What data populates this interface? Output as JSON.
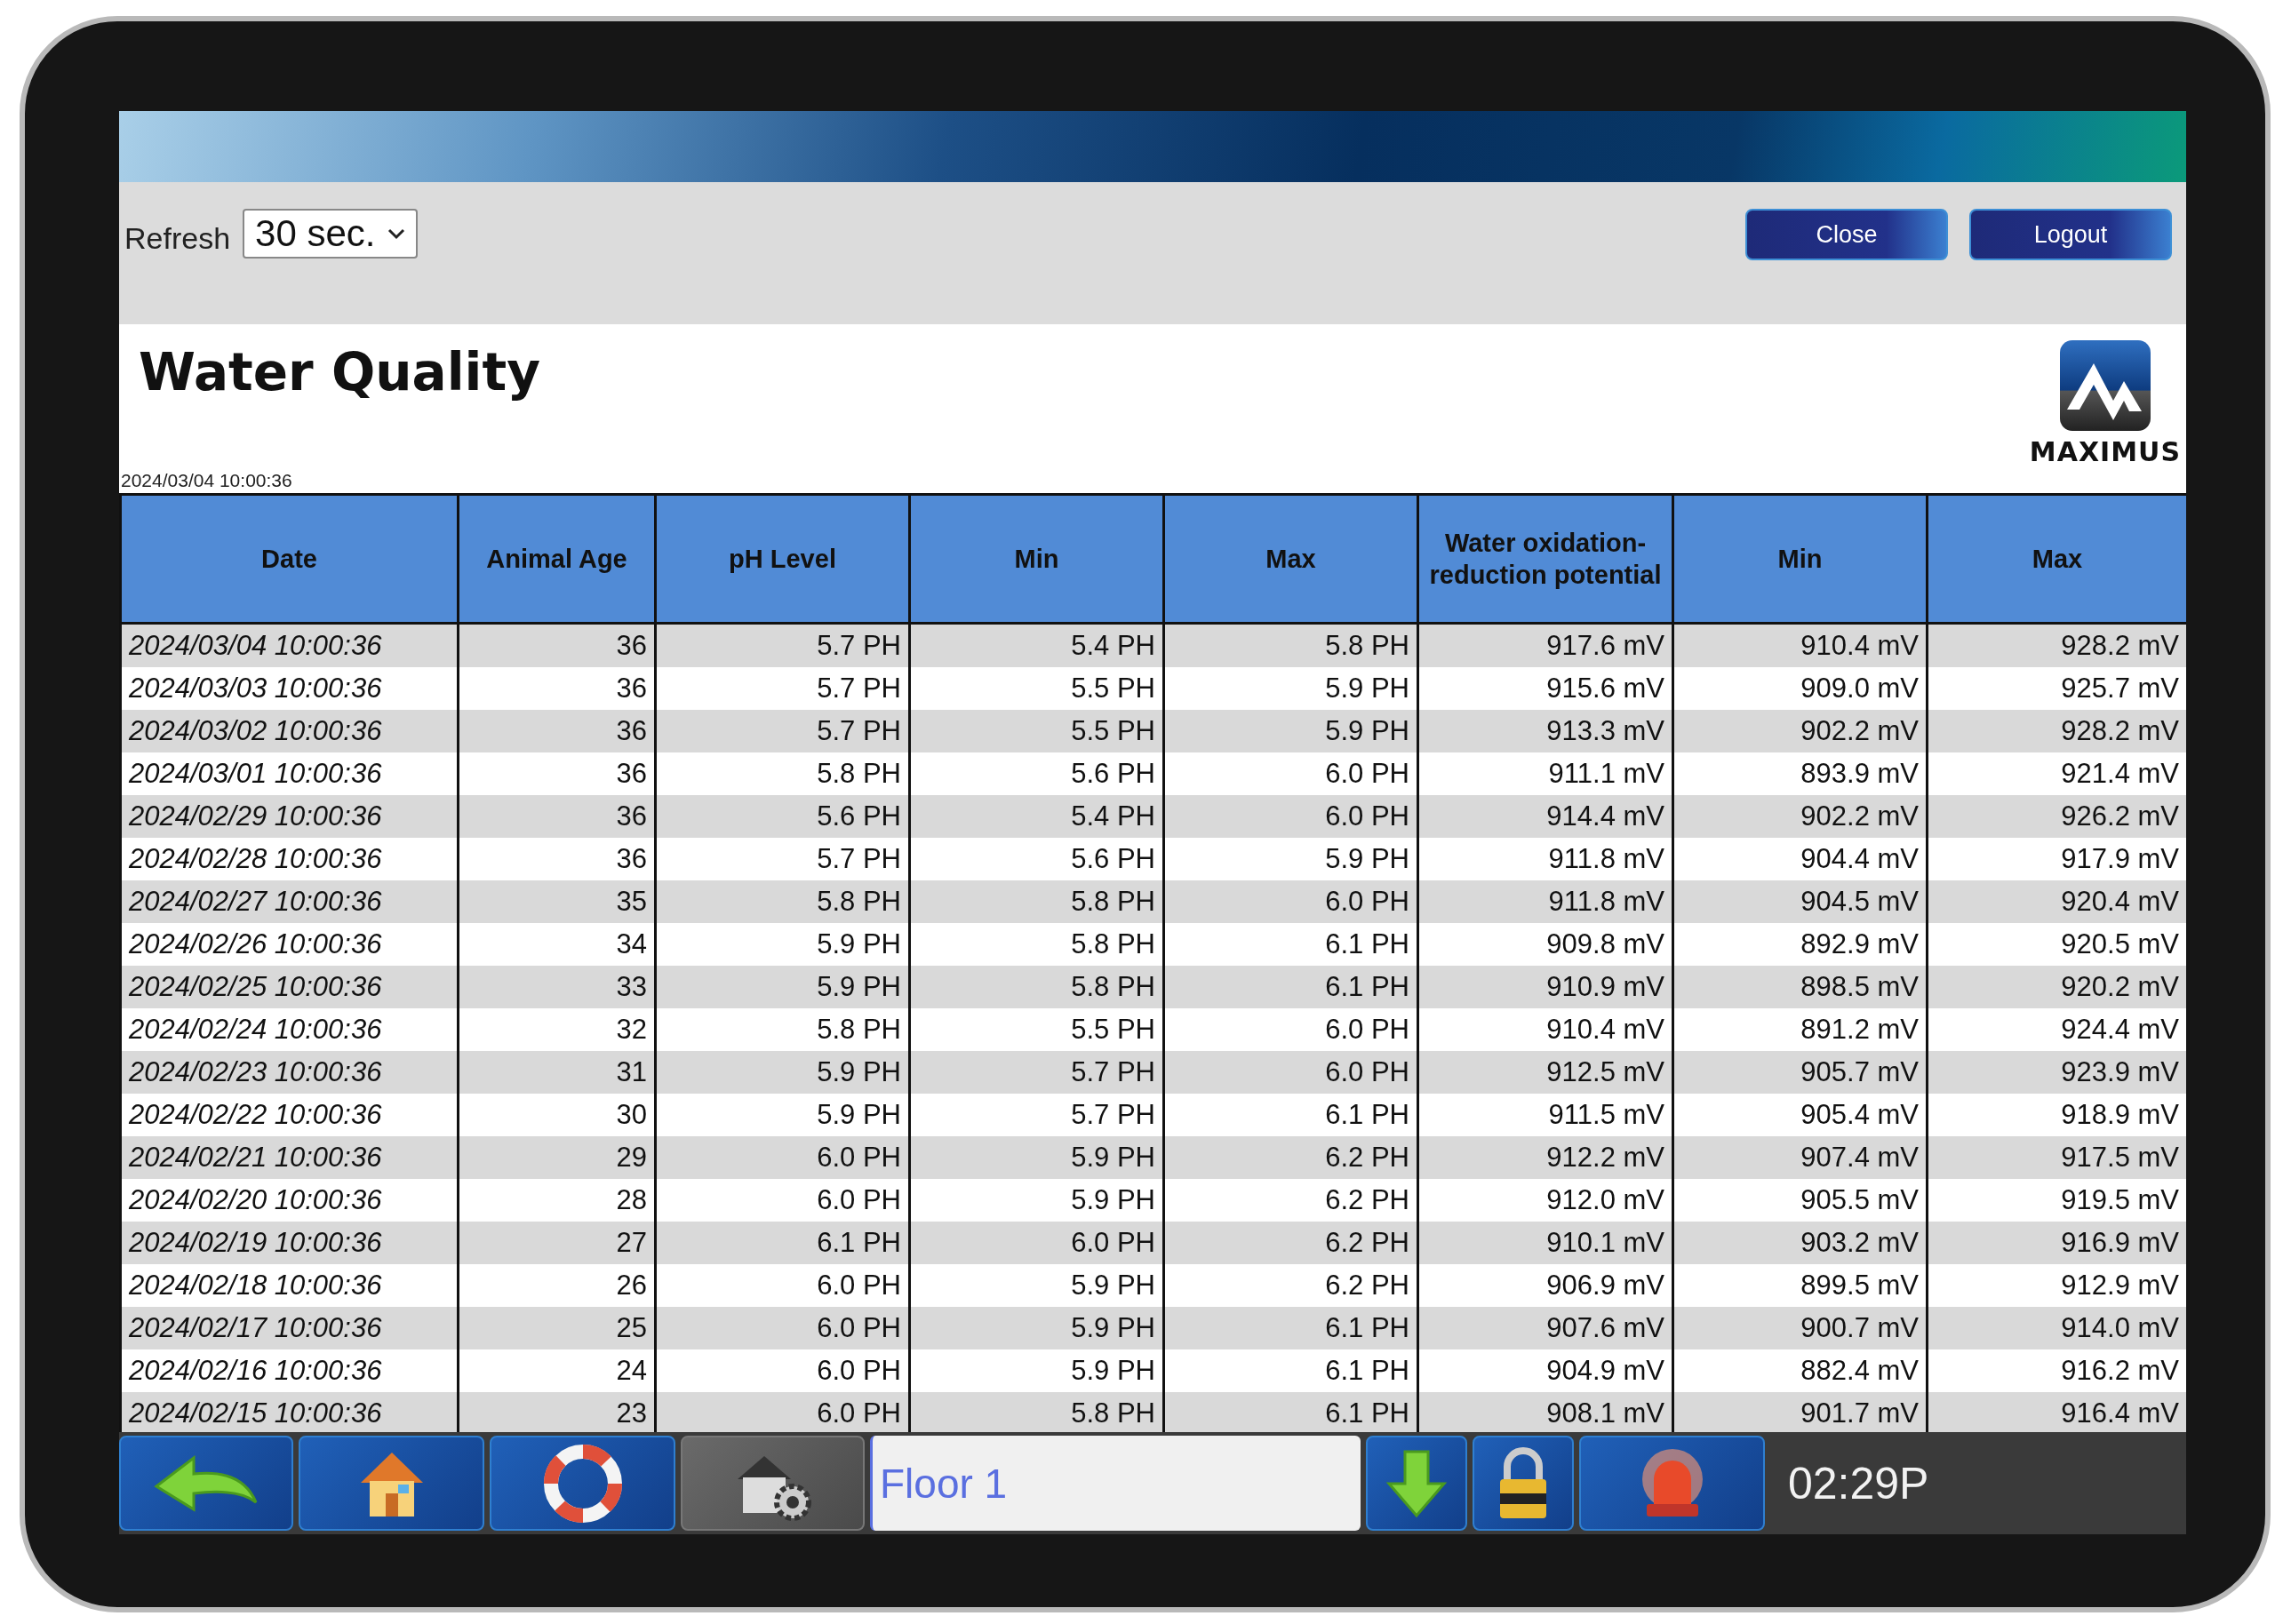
{
  "toolbar": {
    "refresh_label": "Refresh",
    "refresh_value": "30 sec.",
    "buttons": [
      "Close",
      "Logout"
    ]
  },
  "title": "Water Quality",
  "timestamp": "2024/03/04 10:00:36",
  "logo_text": "MAXIMUS",
  "table": {
    "columns": [
      "Date",
      "Animal Age",
      "pH Level",
      "Min",
      "Max",
      "Water oxidation-reduction potential",
      "Min",
      "Max"
    ],
    "rows": [
      [
        "2024/03/04 10:00:36",
        "36",
        "5.7 PH",
        "5.4 PH",
        "5.8 PH",
        "917.6 mV",
        "910.4 mV",
        "928.2 mV"
      ],
      [
        "2024/03/03 10:00:36",
        "36",
        "5.7 PH",
        "5.5 PH",
        "5.9 PH",
        "915.6 mV",
        "909.0 mV",
        "925.7 mV"
      ],
      [
        "2024/03/02 10:00:36",
        "36",
        "5.7 PH",
        "5.5 PH",
        "5.9 PH",
        "913.3 mV",
        "902.2 mV",
        "928.2 mV"
      ],
      [
        "2024/03/01 10:00:36",
        "36",
        "5.8 PH",
        "5.6 PH",
        "6.0 PH",
        "911.1 mV",
        "893.9 mV",
        "921.4 mV"
      ],
      [
        "2024/02/29 10:00:36",
        "36",
        "5.6 PH",
        "5.4 PH",
        "6.0 PH",
        "914.4 mV",
        "902.2 mV",
        "926.2 mV"
      ],
      [
        "2024/02/28 10:00:36",
        "36",
        "5.7 PH",
        "5.6 PH",
        "5.9 PH",
        "911.8 mV",
        "904.4 mV",
        "917.9 mV"
      ],
      [
        "2024/02/27 10:00:36",
        "35",
        "5.8 PH",
        "5.8 PH",
        "6.0 PH",
        "911.8 mV",
        "904.5 mV",
        "920.4 mV"
      ],
      [
        "2024/02/26 10:00:36",
        "34",
        "5.9 PH",
        "5.8 PH",
        "6.1 PH",
        "909.8 mV",
        "892.9 mV",
        "920.5 mV"
      ],
      [
        "2024/02/25 10:00:36",
        "33",
        "5.9 PH",
        "5.8 PH",
        "6.1 PH",
        "910.9 mV",
        "898.5 mV",
        "920.2 mV"
      ],
      [
        "2024/02/24 10:00:36",
        "32",
        "5.8 PH",
        "5.5 PH",
        "6.0 PH",
        "910.4 mV",
        "891.2 mV",
        "924.4 mV"
      ],
      [
        "2024/02/23 10:00:36",
        "31",
        "5.9 PH",
        "5.7 PH",
        "6.0 PH",
        "912.5 mV",
        "905.7 mV",
        "923.9 mV"
      ],
      [
        "2024/02/22 10:00:36",
        "30",
        "5.9 PH",
        "5.7 PH",
        "6.1 PH",
        "911.5 mV",
        "905.4 mV",
        "918.9 mV"
      ],
      [
        "2024/02/21 10:00:36",
        "29",
        "6.0 PH",
        "5.9 PH",
        "6.2 PH",
        "912.2 mV",
        "907.4 mV",
        "917.5 mV"
      ],
      [
        "2024/02/20 10:00:36",
        "28",
        "6.0 PH",
        "5.9 PH",
        "6.2 PH",
        "912.0 mV",
        "905.5 mV",
        "919.5 mV"
      ],
      [
        "2024/02/19 10:00:36",
        "27",
        "6.1 PH",
        "6.0 PH",
        "6.2 PH",
        "910.1 mV",
        "903.2 mV",
        "916.9 mV"
      ],
      [
        "2024/02/18 10:00:36",
        "26",
        "6.0 PH",
        "5.9 PH",
        "6.2 PH",
        "906.9 mV",
        "899.5 mV",
        "912.9 mV"
      ],
      [
        "2024/02/17 10:00:36",
        "25",
        "6.0 PH",
        "5.9 PH",
        "6.1 PH",
        "907.6 mV",
        "900.7 mV",
        "914.0 mV"
      ],
      [
        "2024/02/16 10:00:36",
        "24",
        "6.0 PH",
        "5.9 PH",
        "6.1 PH",
        "904.9 mV",
        "882.4 mV",
        "916.2 mV"
      ],
      [
        "2024/02/15 10:00:36",
        "23",
        "6.0 PH",
        "5.8 PH",
        "6.1 PH",
        "908.1 mV",
        "901.7 mV",
        "916.4 mV"
      ]
    ]
  },
  "bottom_bar": {
    "floor": "Floor 1",
    "time": "02:29P"
  }
}
